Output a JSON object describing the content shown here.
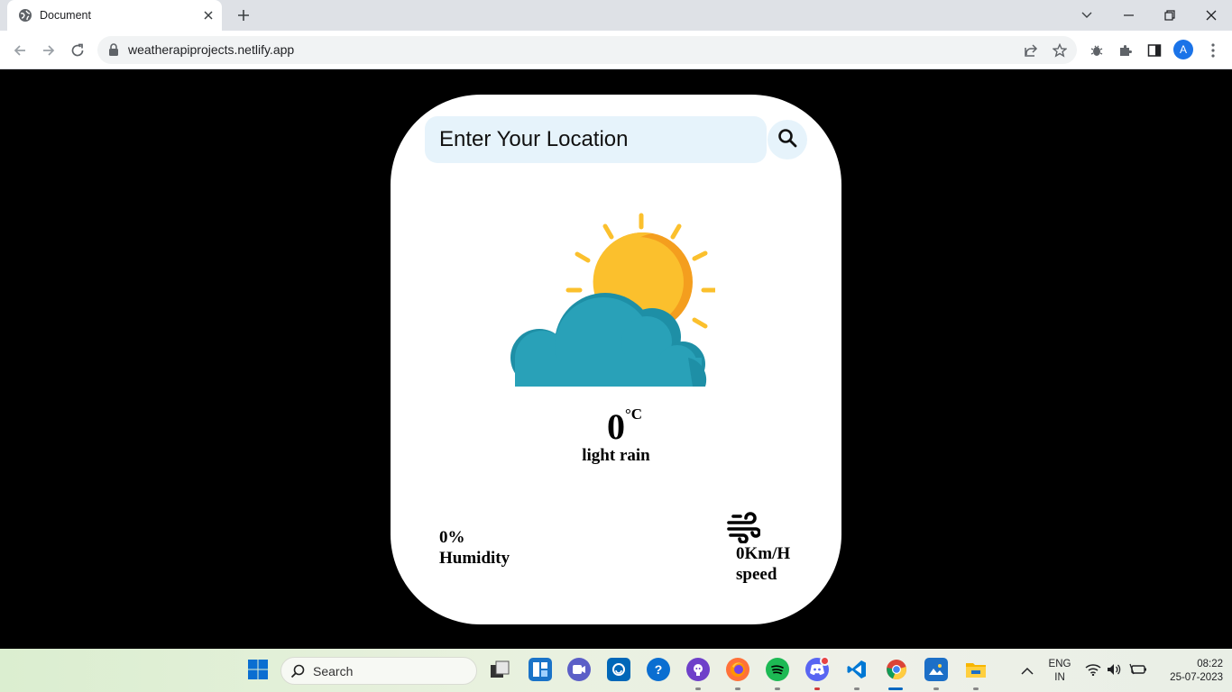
{
  "browser": {
    "tab_title": "Document",
    "url": "weatherapiprojects.netlify.app",
    "profile_initial": "A"
  },
  "weather": {
    "search_placeholder": "Enter Your Location",
    "temperature": "0",
    "temperature_unit": "°C",
    "description": "light rain",
    "humidity_value": "0%",
    "humidity_label": "Humidity",
    "wind_value": "0Km/H",
    "wind_label": "speed",
    "icon": "partly-cloudy-icon"
  },
  "taskbar": {
    "search_label": "Search",
    "language_line1": "ENG",
    "language_line2": "IN",
    "time": "08:22",
    "date": "25-07-2023"
  },
  "colors": {
    "page_background": "#000000",
    "card_background": "#ffffff",
    "input_background": "#e6f3fb",
    "sun": "#fbc02d",
    "cloud": "#29a1b8"
  }
}
